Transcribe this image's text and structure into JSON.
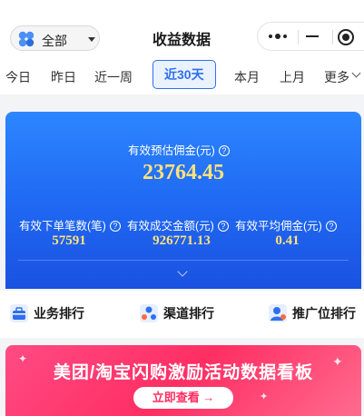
{
  "header": {
    "filter_label": "全部",
    "title": "收益数据"
  },
  "tabs": [
    {
      "label": "今日",
      "active": false
    },
    {
      "label": "昨日",
      "active": false
    },
    {
      "label": "近一周",
      "active": false
    },
    {
      "label": "近30天",
      "active": true
    },
    {
      "label": "本月",
      "active": false
    },
    {
      "label": "上月",
      "active": false
    },
    {
      "label": "更多",
      "active": false
    }
  ],
  "stats": {
    "main": {
      "label": "有效预估佣金(元)",
      "value": "23764.45"
    },
    "sub": [
      {
        "label": "有效下单笔数(笔)",
        "value": "57591"
      },
      {
        "label": "有效成交金额(元)",
        "value": "926771.13"
      },
      {
        "label": "有效平均佣金(元)",
        "value": "0.41"
      }
    ],
    "help_glyph": "?"
  },
  "rankings": [
    {
      "label": "业务排行",
      "icon": "briefcase-icon"
    },
    {
      "label": "渠道排行",
      "icon": "channel-icon"
    },
    {
      "label": "推广位排行",
      "icon": "person-icon"
    }
  ],
  "banner": {
    "title": "美团/淘宝闪购激励活动数据看板",
    "button_label": "立即查看 →"
  },
  "colors": {
    "accent": "#2f6fee",
    "card_top": "#2c86ff",
    "card_bottom": "#1a52e0",
    "value_yellow": "#ffe27a",
    "banner_pink": "#ff2e63"
  }
}
